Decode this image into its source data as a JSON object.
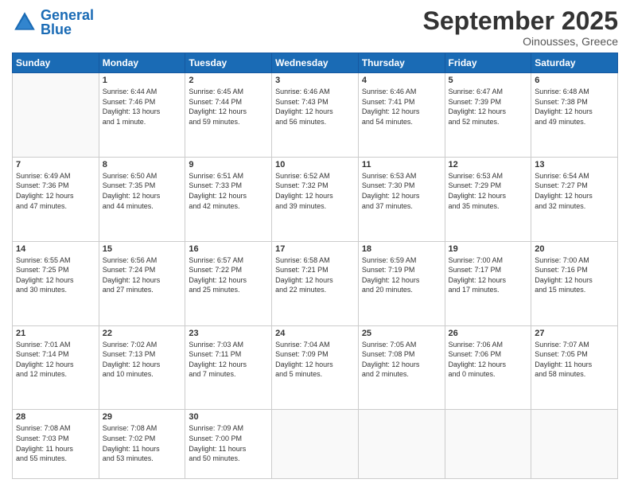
{
  "header": {
    "logo_text_part1": "General",
    "logo_text_part2": "Blue",
    "month": "September 2025",
    "location": "Oinousses, Greece"
  },
  "weekdays": [
    "Sunday",
    "Monday",
    "Tuesday",
    "Wednesday",
    "Thursday",
    "Friday",
    "Saturday"
  ],
  "weeks": [
    [
      {
        "day": "",
        "info": ""
      },
      {
        "day": "1",
        "info": "Sunrise: 6:44 AM\nSunset: 7:46 PM\nDaylight: 13 hours\nand 1 minute."
      },
      {
        "day": "2",
        "info": "Sunrise: 6:45 AM\nSunset: 7:44 PM\nDaylight: 12 hours\nand 59 minutes."
      },
      {
        "day": "3",
        "info": "Sunrise: 6:46 AM\nSunset: 7:43 PM\nDaylight: 12 hours\nand 56 minutes."
      },
      {
        "day": "4",
        "info": "Sunrise: 6:46 AM\nSunset: 7:41 PM\nDaylight: 12 hours\nand 54 minutes."
      },
      {
        "day": "5",
        "info": "Sunrise: 6:47 AM\nSunset: 7:39 PM\nDaylight: 12 hours\nand 52 minutes."
      },
      {
        "day": "6",
        "info": "Sunrise: 6:48 AM\nSunset: 7:38 PM\nDaylight: 12 hours\nand 49 minutes."
      }
    ],
    [
      {
        "day": "7",
        "info": "Sunrise: 6:49 AM\nSunset: 7:36 PM\nDaylight: 12 hours\nand 47 minutes."
      },
      {
        "day": "8",
        "info": "Sunrise: 6:50 AM\nSunset: 7:35 PM\nDaylight: 12 hours\nand 44 minutes."
      },
      {
        "day": "9",
        "info": "Sunrise: 6:51 AM\nSunset: 7:33 PM\nDaylight: 12 hours\nand 42 minutes."
      },
      {
        "day": "10",
        "info": "Sunrise: 6:52 AM\nSunset: 7:32 PM\nDaylight: 12 hours\nand 39 minutes."
      },
      {
        "day": "11",
        "info": "Sunrise: 6:53 AM\nSunset: 7:30 PM\nDaylight: 12 hours\nand 37 minutes."
      },
      {
        "day": "12",
        "info": "Sunrise: 6:53 AM\nSunset: 7:29 PM\nDaylight: 12 hours\nand 35 minutes."
      },
      {
        "day": "13",
        "info": "Sunrise: 6:54 AM\nSunset: 7:27 PM\nDaylight: 12 hours\nand 32 minutes."
      }
    ],
    [
      {
        "day": "14",
        "info": "Sunrise: 6:55 AM\nSunset: 7:25 PM\nDaylight: 12 hours\nand 30 minutes."
      },
      {
        "day": "15",
        "info": "Sunrise: 6:56 AM\nSunset: 7:24 PM\nDaylight: 12 hours\nand 27 minutes."
      },
      {
        "day": "16",
        "info": "Sunrise: 6:57 AM\nSunset: 7:22 PM\nDaylight: 12 hours\nand 25 minutes."
      },
      {
        "day": "17",
        "info": "Sunrise: 6:58 AM\nSunset: 7:21 PM\nDaylight: 12 hours\nand 22 minutes."
      },
      {
        "day": "18",
        "info": "Sunrise: 6:59 AM\nSunset: 7:19 PM\nDaylight: 12 hours\nand 20 minutes."
      },
      {
        "day": "19",
        "info": "Sunrise: 7:00 AM\nSunset: 7:17 PM\nDaylight: 12 hours\nand 17 minutes."
      },
      {
        "day": "20",
        "info": "Sunrise: 7:00 AM\nSunset: 7:16 PM\nDaylight: 12 hours\nand 15 minutes."
      }
    ],
    [
      {
        "day": "21",
        "info": "Sunrise: 7:01 AM\nSunset: 7:14 PM\nDaylight: 12 hours\nand 12 minutes."
      },
      {
        "day": "22",
        "info": "Sunrise: 7:02 AM\nSunset: 7:13 PM\nDaylight: 12 hours\nand 10 minutes."
      },
      {
        "day": "23",
        "info": "Sunrise: 7:03 AM\nSunset: 7:11 PM\nDaylight: 12 hours\nand 7 minutes."
      },
      {
        "day": "24",
        "info": "Sunrise: 7:04 AM\nSunset: 7:09 PM\nDaylight: 12 hours\nand 5 minutes."
      },
      {
        "day": "25",
        "info": "Sunrise: 7:05 AM\nSunset: 7:08 PM\nDaylight: 12 hours\nand 2 minutes."
      },
      {
        "day": "26",
        "info": "Sunrise: 7:06 AM\nSunset: 7:06 PM\nDaylight: 12 hours\nand 0 minutes."
      },
      {
        "day": "27",
        "info": "Sunrise: 7:07 AM\nSunset: 7:05 PM\nDaylight: 11 hours\nand 58 minutes."
      }
    ],
    [
      {
        "day": "28",
        "info": "Sunrise: 7:08 AM\nSunset: 7:03 PM\nDaylight: 11 hours\nand 55 minutes."
      },
      {
        "day": "29",
        "info": "Sunrise: 7:08 AM\nSunset: 7:02 PM\nDaylight: 11 hours\nand 53 minutes."
      },
      {
        "day": "30",
        "info": "Sunrise: 7:09 AM\nSunset: 7:00 PM\nDaylight: 11 hours\nand 50 minutes."
      },
      {
        "day": "",
        "info": ""
      },
      {
        "day": "",
        "info": ""
      },
      {
        "day": "",
        "info": ""
      },
      {
        "day": "",
        "info": ""
      }
    ]
  ]
}
